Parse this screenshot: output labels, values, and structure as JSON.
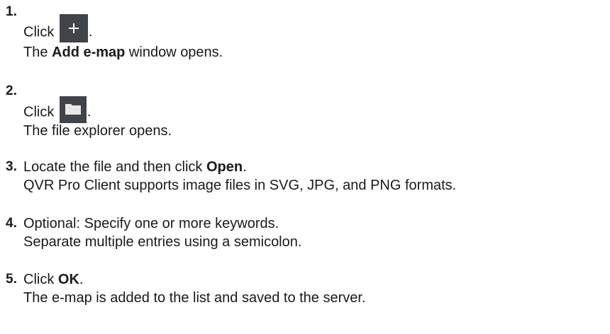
{
  "steps": [
    {
      "number": "1.",
      "line1_prefix": "Click",
      "line1_icon": "plus-icon",
      "line1_suffix": ".",
      "line2_pre": "The ",
      "line2_bold": "Add e-map",
      "line2_post": " window opens."
    },
    {
      "number": "2.",
      "line1_prefix": "Click",
      "line1_icon": "folder-icon",
      "line1_suffix": ".",
      "line2": "The file explorer opens."
    },
    {
      "number": "3.",
      "line1_pre": "Locate the file and then click ",
      "line1_bold": "Open",
      "line1_post": ".",
      "line2": "QVR Pro Client supports image files in SVG, JPG, and PNG formats."
    },
    {
      "number": "4.",
      "line1": "Optional: Specify one or more keywords.",
      "line2": "Separate multiple entries using a semicolon."
    },
    {
      "number": "5.",
      "line1_pre": "Click ",
      "line1_bold": "OK",
      "line1_post": ".",
      "line2": "The e-map is added to the list and saved to the server."
    }
  ],
  "colors": {
    "text": "#1a1a1a",
    "icon_button_bg": "#404448",
    "icon_fg": "#ffffff"
  }
}
